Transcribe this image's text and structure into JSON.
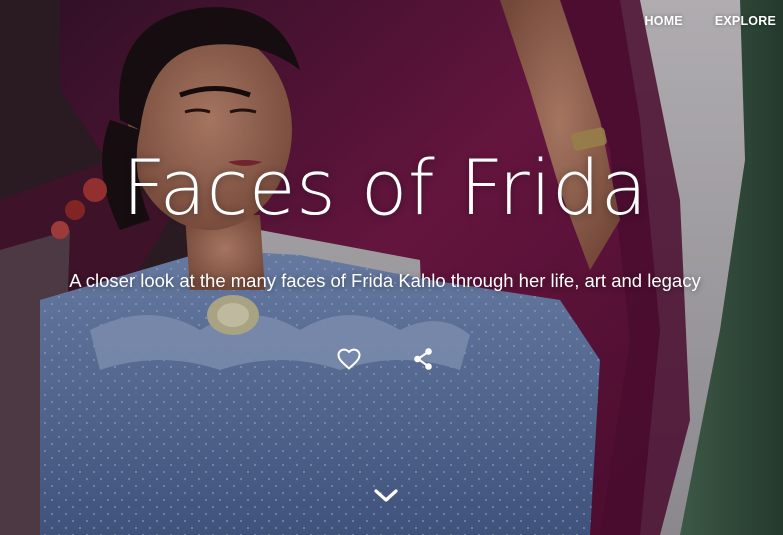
{
  "nav": {
    "home_label": "HOME",
    "explore_label": "EXPLORE"
  },
  "hero": {
    "title": "Faces of Frida",
    "subtitle": "A closer look at the many faces of Frida Kahlo through her life, art and legacy",
    "background_image": "portrait of Frida Kahlo in a blue blouse holding a magenta rebozo shawl"
  },
  "actions": {
    "favorite_icon": "heart-outline-icon",
    "share_icon": "share-icon"
  },
  "scroll": {
    "icon": "chevron-down-icon"
  },
  "colors": {
    "text": "#ffffff",
    "shawl": "#6e1540",
    "blouse": "#6c86b8",
    "sky": "#c9c6cc",
    "foliage": "#3f5e4a"
  }
}
